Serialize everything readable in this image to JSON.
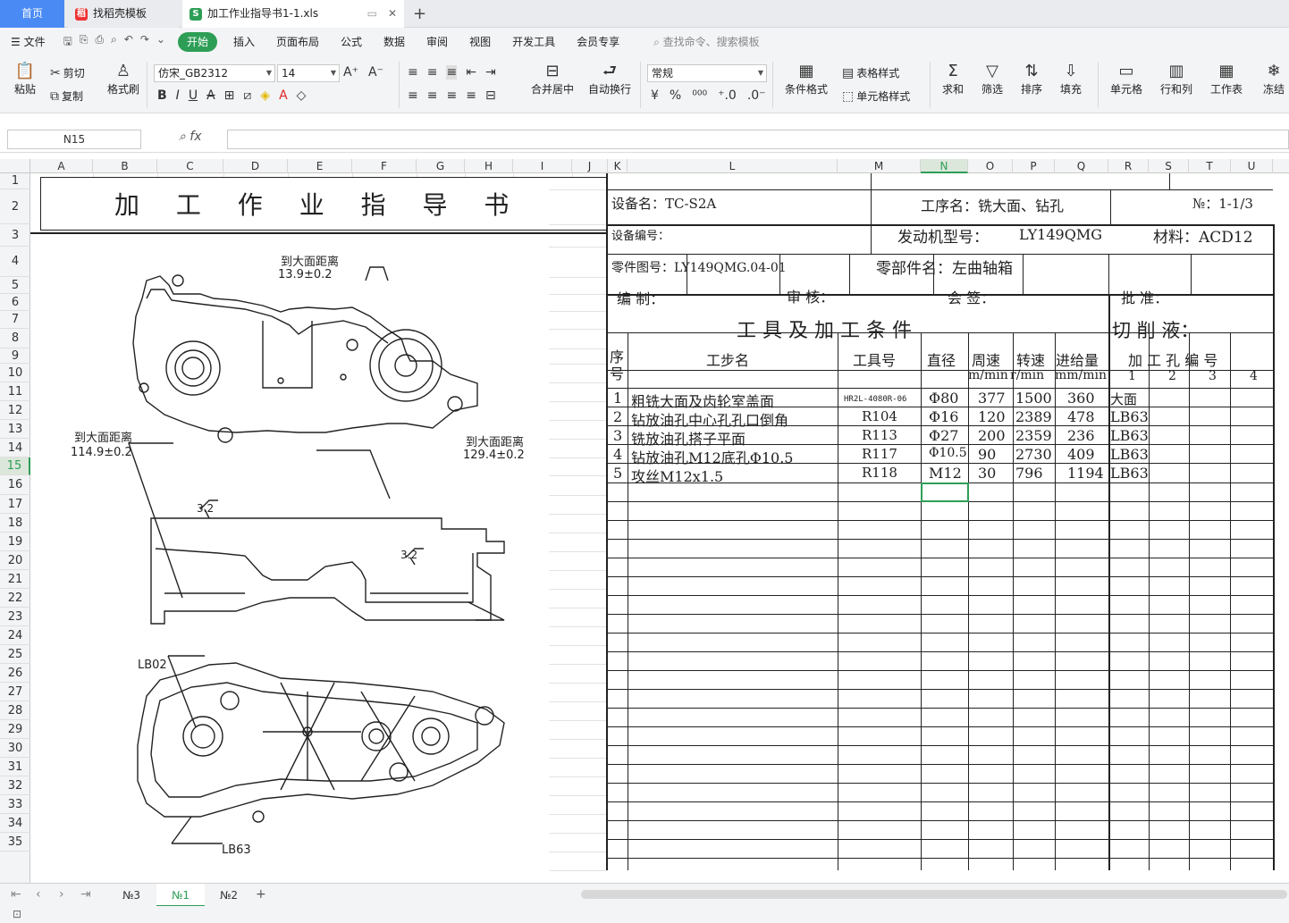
{
  "tabs": {
    "home": "首页",
    "template": "找稻壳模板",
    "file": "加工作业指导书1-1.xls"
  },
  "menu": {
    "file": "文件",
    "items": [
      "开始",
      "插入",
      "页面布局",
      "公式",
      "数据",
      "审阅",
      "视图",
      "开发工具",
      "会员专享"
    ],
    "search": "查找命令、搜索模板"
  },
  "ribbon": {
    "paste": "粘贴",
    "cut": "剪切",
    "copy": "复制",
    "format_painter": "格式刷",
    "font_name": "仿宋_GB2312",
    "font_size": "14",
    "merge": "合并居中",
    "wrap": "自动换行",
    "number_format": "常规",
    "cond_format": "条件格式",
    "table_style": "表格样式",
    "cell_style": "单元格样式",
    "sum": "求和",
    "filter": "筛选",
    "sort": "排序",
    "fill": "填充",
    "cell": "单元格",
    "rowcol": "行和列",
    "worksheet": "工作表",
    "freeze": "冻结"
  },
  "formula": {
    "name_box": "N15",
    "fx": "fx",
    "value": ""
  },
  "columns": [
    "A",
    "B",
    "C",
    "D",
    "E",
    "F",
    "G",
    "H",
    "I",
    "J",
    "K",
    "L",
    "M",
    "N",
    "O",
    "P",
    "Q",
    "R",
    "S",
    "T",
    "U"
  ],
  "rows": [
    "1",
    "2",
    "3",
    "4",
    "5",
    "6",
    "7",
    "8",
    "9",
    "10",
    "11",
    "12",
    "13",
    "14",
    "15",
    "16",
    "17",
    "18",
    "19",
    "20",
    "21",
    "22",
    "23",
    "24",
    "25",
    "26",
    "27",
    "28",
    "29",
    "30",
    "31",
    "32",
    "33",
    "34",
    "35"
  ],
  "doc": {
    "title": "加 工 作 业 指 导 书",
    "equip_name": "设备名：TC-S2A",
    "process_name": "工序名：铣大面、钻孔",
    "page_no": "№：1-1/3",
    "equip_no": "设备编号：",
    "engine_model_label": "发动机型号：",
    "engine_model": "LY149QMG",
    "material": "材料：ACD12",
    "part_drawing": "零件图号：LY149QMG.04-01",
    "part_name": "零部件名：左曲轴箱",
    "editor": "编 制：",
    "reviewer": "审 核：",
    "countersign": "会 签：",
    "approver": "批 准：",
    "tools_header": "工 具 及 加 工 条 件",
    "coolant": "切 削 液：",
    "h_seq": "序",
    "h_seq2": "号",
    "h_step": "工步名",
    "h_tool": "工具号",
    "h_dia": "直径",
    "h_speed": "周速",
    "h_speed_unit": "m/min",
    "h_rpm": "转速",
    "h_rpm_unit": "r/min",
    "h_feed": "进给量",
    "h_feed_unit": "mm/min",
    "h_holes": "加 工 孔 编 号",
    "hole_cols": [
      "1",
      "2",
      "3",
      "4"
    ],
    "steps": [
      {
        "seq": "1",
        "name": "粗铣大面及齿轮室盖面",
        "tool": "HR2L-4080R-06",
        "dia": "Φ80",
        "speed": "377",
        "rpm": "1500",
        "feed": "360",
        "hole1": "大面"
      },
      {
        "seq": "2",
        "name": "钻放油孔中心孔孔口倒角",
        "tool": "R104",
        "dia": "Φ16",
        "speed": "120",
        "rpm": "2389",
        "feed": "478",
        "hole1": "LB63"
      },
      {
        "seq": "3",
        "name": "铣放油孔搭子平面",
        "tool": "R113",
        "dia": "Φ27",
        "speed": "200",
        "rpm": "2359",
        "feed": "236",
        "hole1": "LB63"
      },
      {
        "seq": "4",
        "name": "钻放油孔M12底孔Φ10.5",
        "tool": "R117",
        "dia": "Φ10.5",
        "speed": "90",
        "rpm": "2730",
        "feed": "409",
        "hole1": "LB63"
      },
      {
        "seq": "5",
        "name": "攻丝M12x1.5",
        "tool": "R118",
        "dia": "M12",
        "speed": "30",
        "rpm": "796",
        "feed": "1194",
        "hole1": "LB63"
      }
    ],
    "dim1_label": "到大面距离",
    "dim1_value": "13.9±0.2",
    "dim2_label": "到大面距离",
    "dim2_value": "114.9±0.2",
    "dim3_label": "到大面距离",
    "dim3_value": "129.4±0.2",
    "rough1": "3.2",
    "rough2": "3.2",
    "lb02": "LB02",
    "lb63": "LB63"
  },
  "sheets": {
    "s1": "№3",
    "s2": "№1",
    "s3": "№2"
  }
}
